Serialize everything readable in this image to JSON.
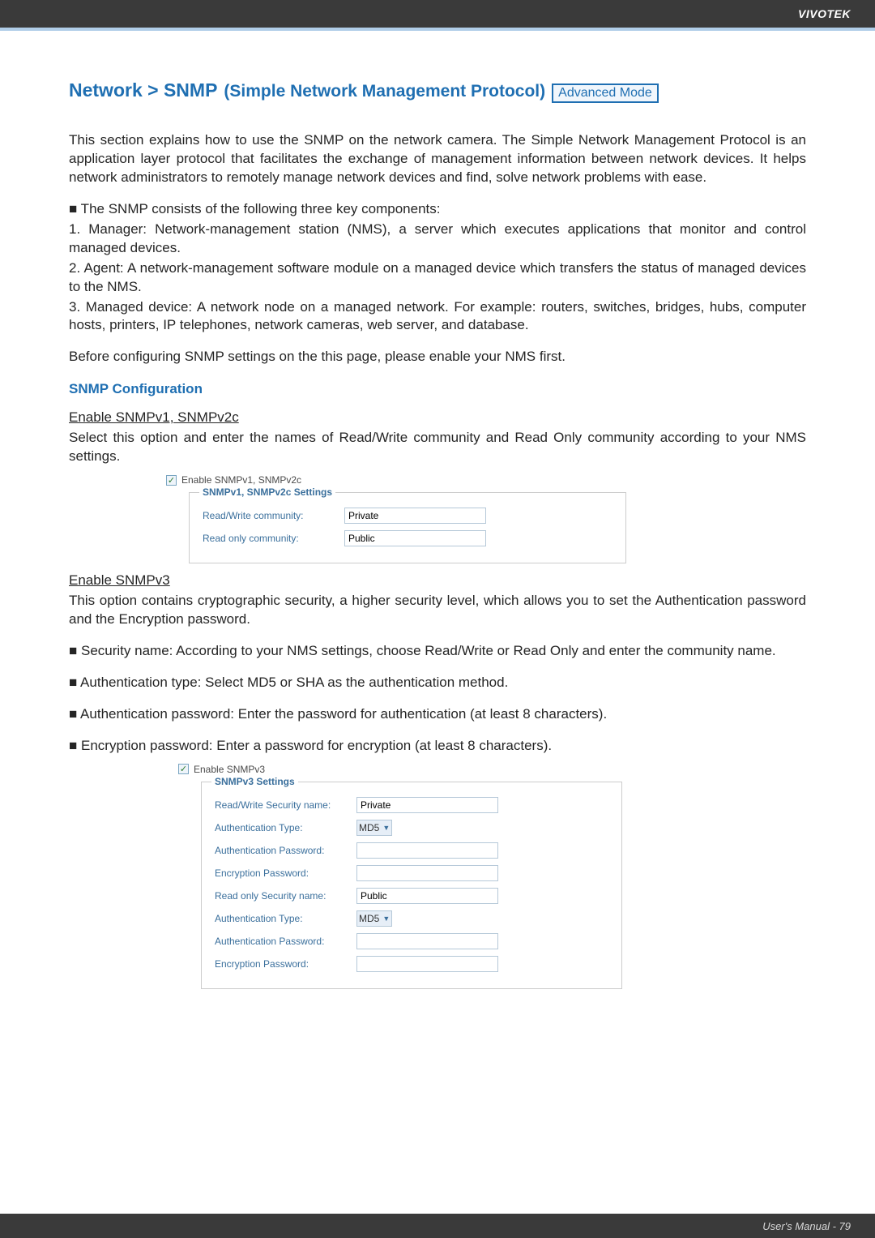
{
  "header": {
    "brand": "VIVOTEK"
  },
  "title": {
    "main": "Network > SNMP",
    "sub": "(Simple Network Management Protocol)",
    "badge": "Advanced Mode"
  },
  "intro": "This section explains how to use the SNMP on the network camera. The Simple Network Management Protocol is an application layer protocol that facilitates the exchange of management information between network devices. It helps network administrators to remotely manage network devices and find, solve network problems with ease.",
  "components_lead": "■ The SNMP consists of the following three key components:",
  "components": {
    "item1": "1. Manager: Network-management station (NMS), a server which executes applications that monitor and control managed devices.",
    "item2": "2. Agent: A network-management software module on a managed device which transfers the status of managed devices to the NMS.",
    "item3": "3. Managed device: A network node on a managed network. For example: routers, switches, bridges, hubs, computer hosts, printers, IP telephones, network cameras, web server, and database."
  },
  "before_note": "Before configuring SNMP settings on the this page, please enable your NMS first.",
  "snmp_config_heading": "SNMP Configuration",
  "v1v2c": {
    "heading": "Enable SNMPv1, SNMPv2c",
    "desc": "Select this option and enter the names of Read/Write community and Read Only community according to your NMS settings.",
    "checkbox_label": "Enable SNMPv1, SNMPv2c",
    "legend": "SNMPv1, SNMPv2c Settings",
    "rw_label": "Read/Write community:",
    "rw_value": "Private",
    "ro_label": "Read only community:",
    "ro_value": "Public"
  },
  "v3": {
    "heading": "Enable SNMPv3",
    "desc": "This option contains cryptographic security, a higher security level, which allows you to set the Authentication password and the Encryption password.",
    "bullets": {
      "b1": "■ Security name: According to your NMS settings, choose Read/Write or Read Only and enter the community name.",
      "b2": "■ Authentication type: Select MD5 or SHA as the authentication method.",
      "b3": "■ Authentication password: Enter the password for authentication (at least 8 characters).",
      "b4": "■ Encryption password: Enter a password for encryption (at least 8 characters)."
    },
    "checkbox_label": "Enable SNMPv3",
    "legend": "SNMPv3 Settings",
    "rw_sec_label": "Read/Write Security name:",
    "rw_sec_value": "Private",
    "auth_type_label": "Authentication Type:",
    "auth_type_value": "MD5",
    "auth_pw_label": "Authentication Password:",
    "enc_pw_label": "Encryption Password:",
    "ro_sec_label": "Read only Security name:",
    "ro_sec_value": "Public",
    "auth_type2_value": "MD5"
  },
  "footer": {
    "text": "User's Manual - 79"
  }
}
